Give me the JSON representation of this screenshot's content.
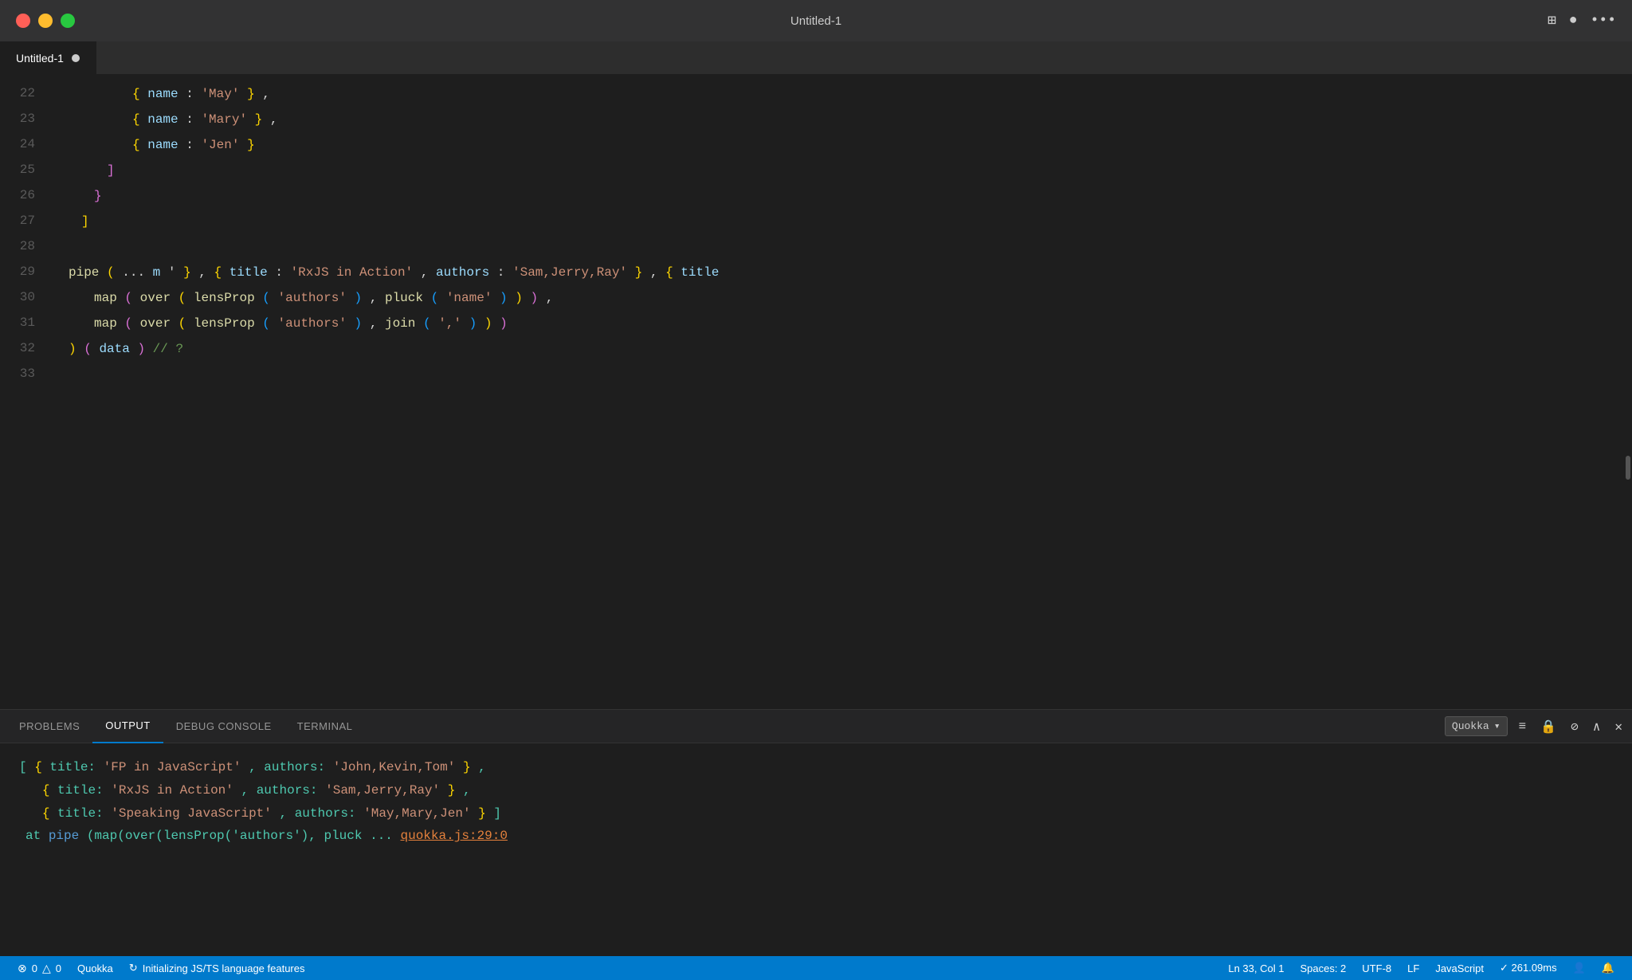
{
  "titlebar": {
    "title": "Untitled-1",
    "traffic": {
      "close": "close",
      "minimize": "minimize",
      "maximize": "maximize"
    }
  },
  "tab": {
    "label": "Untitled-1",
    "dot": true
  },
  "editor": {
    "lines": [
      {
        "num": 22,
        "content": "name_may"
      },
      {
        "num": 23,
        "content": "name_mary"
      },
      {
        "num": 24,
        "content": "name_jen"
      },
      {
        "num": 25,
        "content": "bracket_close_array"
      },
      {
        "num": 26,
        "content": "bracket_close_obj"
      },
      {
        "num": 27,
        "content": "bracket_close_arr2"
      },
      {
        "num": 28,
        "content": "empty"
      },
      {
        "num": 29,
        "content": "pipe_line",
        "breakpoint": true
      },
      {
        "num": 30,
        "content": "map_over_1"
      },
      {
        "num": 31,
        "content": "map_over_2"
      },
      {
        "num": 32,
        "content": "data_line"
      },
      {
        "num": 33,
        "content": "empty2"
      }
    ]
  },
  "panel": {
    "tabs": [
      {
        "label": "PROBLEMS",
        "active": false
      },
      {
        "label": "OUTPUT",
        "active": true
      },
      {
        "label": "DEBUG CONSOLE",
        "active": false
      },
      {
        "label": "TERMINAL",
        "active": false
      }
    ],
    "filter_label": "Quokka",
    "output": {
      "line1": "[ { title: 'FP in JavaScript', authors: 'John,Kevin,Tom' },",
      "line2": "  { title: 'RxJS in Action', authors: 'Sam,Jerry,Ray' },",
      "line3": "  { title: 'Speaking JavaScript', authors: 'May,Mary,Jen' } ]",
      "line4_prefix": "  at ",
      "line4_code": "pipe(map(over(lensProp('authors'), pluck ...",
      "line4_link": "quokka.js:29:0"
    }
  },
  "statusbar": {
    "errors": "0",
    "warnings": "0",
    "quokka_label": "Quokka",
    "language_status": "Initializing JS/TS language features",
    "position": "Ln 33, Col 1",
    "spaces": "Spaces: 2",
    "encoding": "UTF-8",
    "eol": "LF",
    "language": "JavaScript",
    "timing": "✓ 261.09ms",
    "sync_icon": "sync",
    "bell_icon": "bell"
  }
}
